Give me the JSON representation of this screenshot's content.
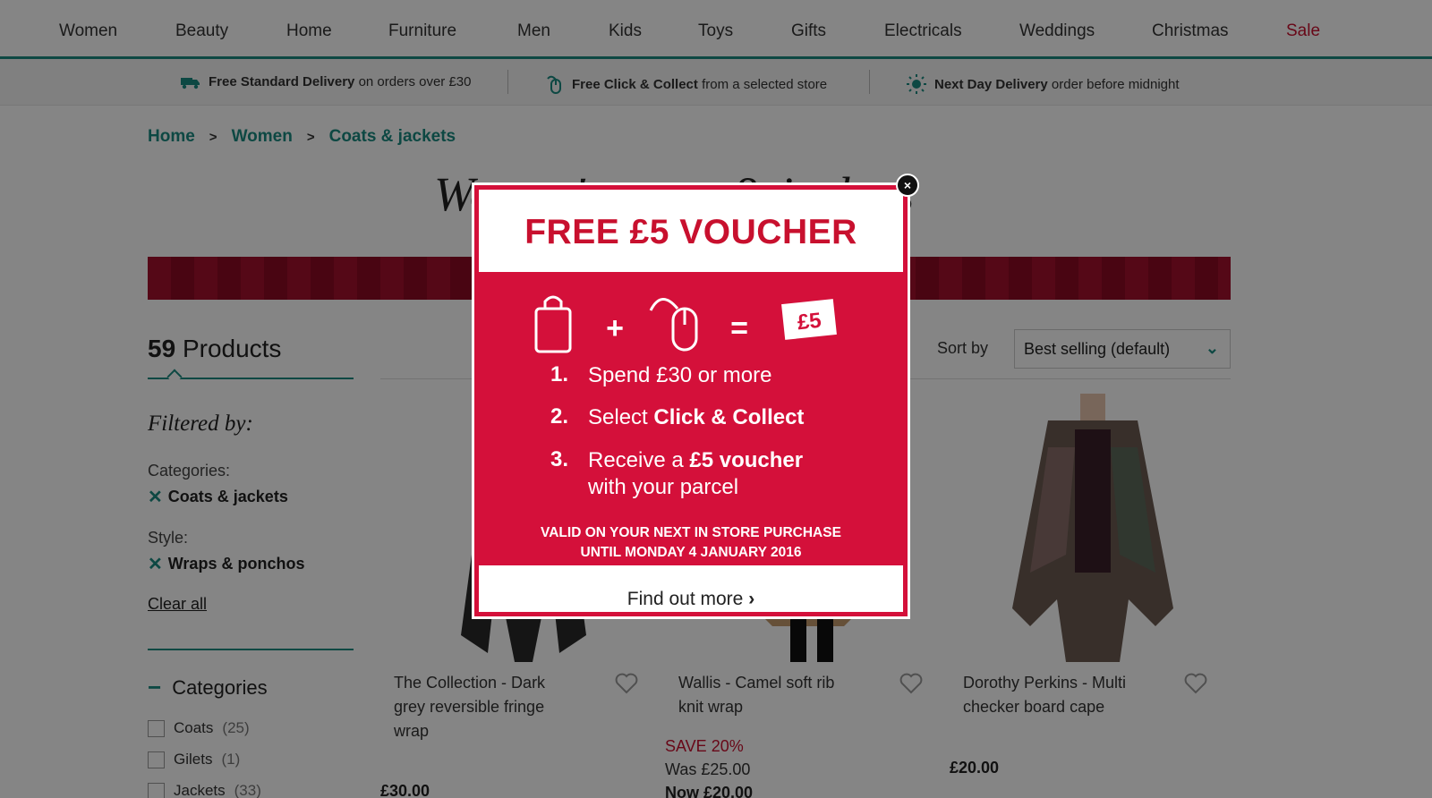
{
  "nav": {
    "items": [
      "Women",
      "Beauty",
      "Home",
      "Furniture",
      "Men",
      "Kids",
      "Toys",
      "Gifts",
      "Electricals",
      "Weddings",
      "Christmas",
      "Sale"
    ],
    "sale_color": "#c8102e"
  },
  "delivery": {
    "standard_bold": "Free Standard Delivery",
    "standard_rest": "on orders over £30",
    "click_bold": "Free Click & Collect",
    "click_rest": "from a selected store",
    "next_bold": "Next Day Delivery",
    "next_rest": "order before midnight"
  },
  "breadcrumb": [
    "Home",
    "Women",
    "Coats & jackets"
  ],
  "breadcrumb_sep": ">",
  "page_title": "Women's coats & jackets",
  "products": {
    "count": "59",
    "label": "Products"
  },
  "filters": {
    "heading": "Filtered by:",
    "categories_label": "Categories:",
    "categories_value": "Coats & jackets",
    "style_label": "Style:",
    "style_value": "Wraps & ponchos",
    "clear_all": "Clear all",
    "remove_icon": "close-x-icon"
  },
  "categories": {
    "heading": "Categories",
    "items": [
      {
        "label": "Coats",
        "count": "(25)"
      },
      {
        "label": "Gilets",
        "count": "(1)"
      },
      {
        "label": "Jackets",
        "count": "(33)"
      }
    ]
  },
  "sort": {
    "label": "Sort by",
    "value": "Best selling (default)"
  },
  "cards": [
    {
      "name": "The Collection - Dark grey reversible fringe wrap",
      "price": "£30.00"
    },
    {
      "name": "Wallis - Camel soft rib knit wrap",
      "save": "SAVE 20%",
      "was": "Was £25.00",
      "now": "Now £20.00"
    },
    {
      "name": "Dorothy Perkins - Multi checker board cape",
      "price": "£20.00"
    }
  ],
  "modal": {
    "title": "FREE £5 VOUCHER",
    "voucher_value": "£5",
    "plus": "+",
    "equals": "=",
    "steps": [
      {
        "num": "1.",
        "text": "Spend £30 or more"
      },
      {
        "num": "2.",
        "text_pre": "Select ",
        "text_bold": "Click & Collect"
      },
      {
        "num": "3.",
        "text_pre": "Receive a ",
        "text_bold": "£5 voucher",
        "text_line2": "with your parcel"
      }
    ],
    "valid_line1": "VALID ON YOUR NEXT IN STORE PURCHASE",
    "valid_line2": "UNTIL MONDAY 4 JANUARY 2016",
    "cta": "Find out more",
    "close": "×",
    "accent_color": "#d4103a"
  }
}
